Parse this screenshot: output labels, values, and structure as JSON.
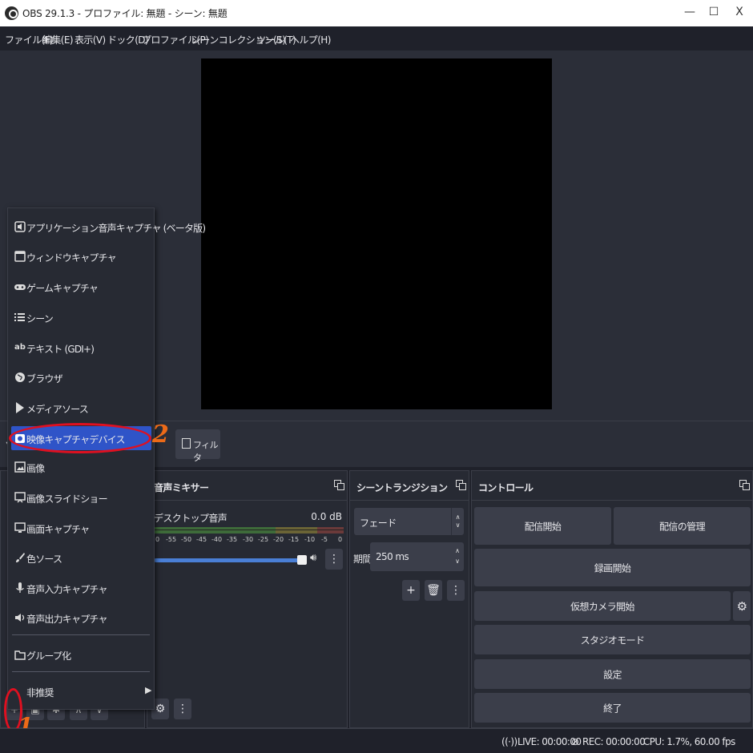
{
  "window": {
    "title": "OBS 29.1.3 - プロファイル: 無題 - シーン: 無題",
    "minimize": "—",
    "maximize": "☐",
    "close": "X"
  },
  "menubar": [
    "ファイル(F)",
    "編集(E)",
    "表示(V)",
    "ドック(D)",
    "プロファイル(P)",
    "シーンコレクション(S)",
    "ツール(T)",
    "ヘルプ(H)"
  ],
  "source_toolbar": {
    "filter_label": "フィルタ"
  },
  "add_source_menu": {
    "items": [
      {
        "label": "アプリケーション音声キャプチャ (ベータ版)",
        "icon": "speaker-window-icon"
      },
      {
        "label": "ウィンドウキャプチャ",
        "icon": "window-icon"
      },
      {
        "label": "ゲームキャプチャ",
        "icon": "gamepad-icon"
      },
      {
        "label": "シーン",
        "icon": "list-icon"
      },
      {
        "label": "テキスト (GDI+)",
        "icon": "text-icon"
      },
      {
        "label": "ブラウザ",
        "icon": "globe-icon"
      },
      {
        "label": "メディアソース",
        "icon": "play-icon"
      },
      {
        "label": "映像キャプチャデバイス",
        "icon": "camera-icon",
        "active": true
      },
      {
        "label": "画像",
        "icon": "image-icon"
      },
      {
        "label": "画像スライドショー",
        "icon": "slideshow-icon"
      },
      {
        "label": "画面キャプチャ",
        "icon": "monitor-icon"
      },
      {
        "label": "色ソース",
        "icon": "brush-icon"
      },
      {
        "label": "音声入力キャプチャ",
        "icon": "microphone-icon"
      },
      {
        "label": "音声出力キャプチャ",
        "icon": "speaker-icon"
      },
      {
        "label": "グループ化",
        "icon": "folder-icon"
      },
      {
        "label": "非推奨",
        "icon": "",
        "submenu": true
      }
    ]
  },
  "mixer": {
    "title": "音声ミキサー",
    "track_name": "デスクトップ音声",
    "level": "0.0 dB",
    "scale": [
      "0",
      "-55",
      "-50",
      "-45",
      "-40",
      "-35",
      "-30",
      "-25",
      "-20",
      "-15",
      "-10",
      "-5",
      "0"
    ],
    "volume": 1.0
  },
  "transitions": {
    "title": "シーントランジション",
    "selected": "フェード",
    "duration_label": "期間",
    "duration_value": "250 ms"
  },
  "controls": {
    "title": "コントロール",
    "start_streaming": "配信開始",
    "manage_broadcast": "配信の管理",
    "start_recording": "録画開始",
    "start_virtual_cam": "仮想カメラ開始",
    "studio_mode": "スタジオモード",
    "settings": "設定",
    "exit": "終了"
  },
  "annotations": {
    "step1": "1",
    "step2": "2"
  },
  "status": {
    "live": "LIVE: 00:00:00",
    "rec": "REC: 00:00:00",
    "cpu": "CPU: 1.7%, 60.00 fps"
  },
  "colors": {
    "accent": "#2f54c8",
    "annotation_red": "#e01020",
    "annotation_orange": "#ec6a18"
  }
}
